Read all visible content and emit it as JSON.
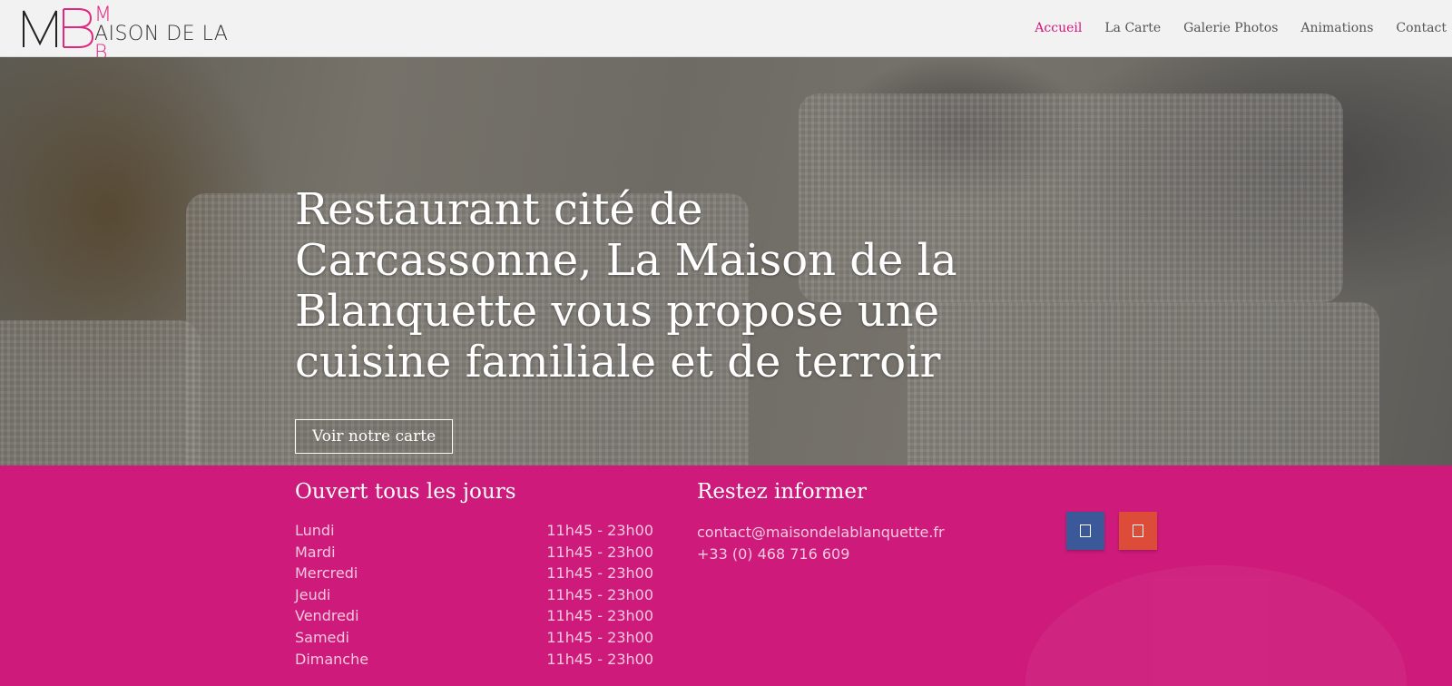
{
  "header": {
    "logo": {
      "monogram": "MB",
      "line1_a": "MAISON DE LA",
      "line2_a": "BLANQUETTE"
    },
    "nav": [
      {
        "label": "Accueil",
        "active": true
      },
      {
        "label": "La Carte",
        "active": false
      },
      {
        "label": "Galerie Photos",
        "active": false
      },
      {
        "label": "Animations",
        "active": false
      },
      {
        "label": "Contact",
        "active": false
      }
    ]
  },
  "hero": {
    "title": "Restaurant cité de Carcassonne, La Maison de la Blanquette vous propose une cuisine familiale et de terroir",
    "cta_label": "Voir notre carte"
  },
  "hours": {
    "heading": "Ouvert tous les jours",
    "rows": [
      {
        "day": "Lundi",
        "time": "11h45 - 23h00"
      },
      {
        "day": "Mardi",
        "time": "11h45 - 23h00"
      },
      {
        "day": "Mercredi",
        "time": "11h45 - 23h00"
      },
      {
        "day": "Jeudi",
        "time": "11h45 - 23h00"
      },
      {
        "day": "Vendredi",
        "time": "11h45 - 23h00"
      },
      {
        "day": "Samedi",
        "time": "11h45 - 23h00"
      },
      {
        "day": "Dimanche",
        "time": "11h45 - 23h00"
      }
    ]
  },
  "info": {
    "heading": "Restez informer",
    "email": "contact@maisondelablanquette.fr",
    "phone": "+33 (0) 468 716 609",
    "social": [
      {
        "icon": "facebook-icon",
        "color": "#3b5998"
      },
      {
        "icon": "google-plus-icon",
        "color": "#dd4b39"
      }
    ]
  },
  "colors": {
    "accent": "#d5137c",
    "band": "#cd1a7b"
  }
}
